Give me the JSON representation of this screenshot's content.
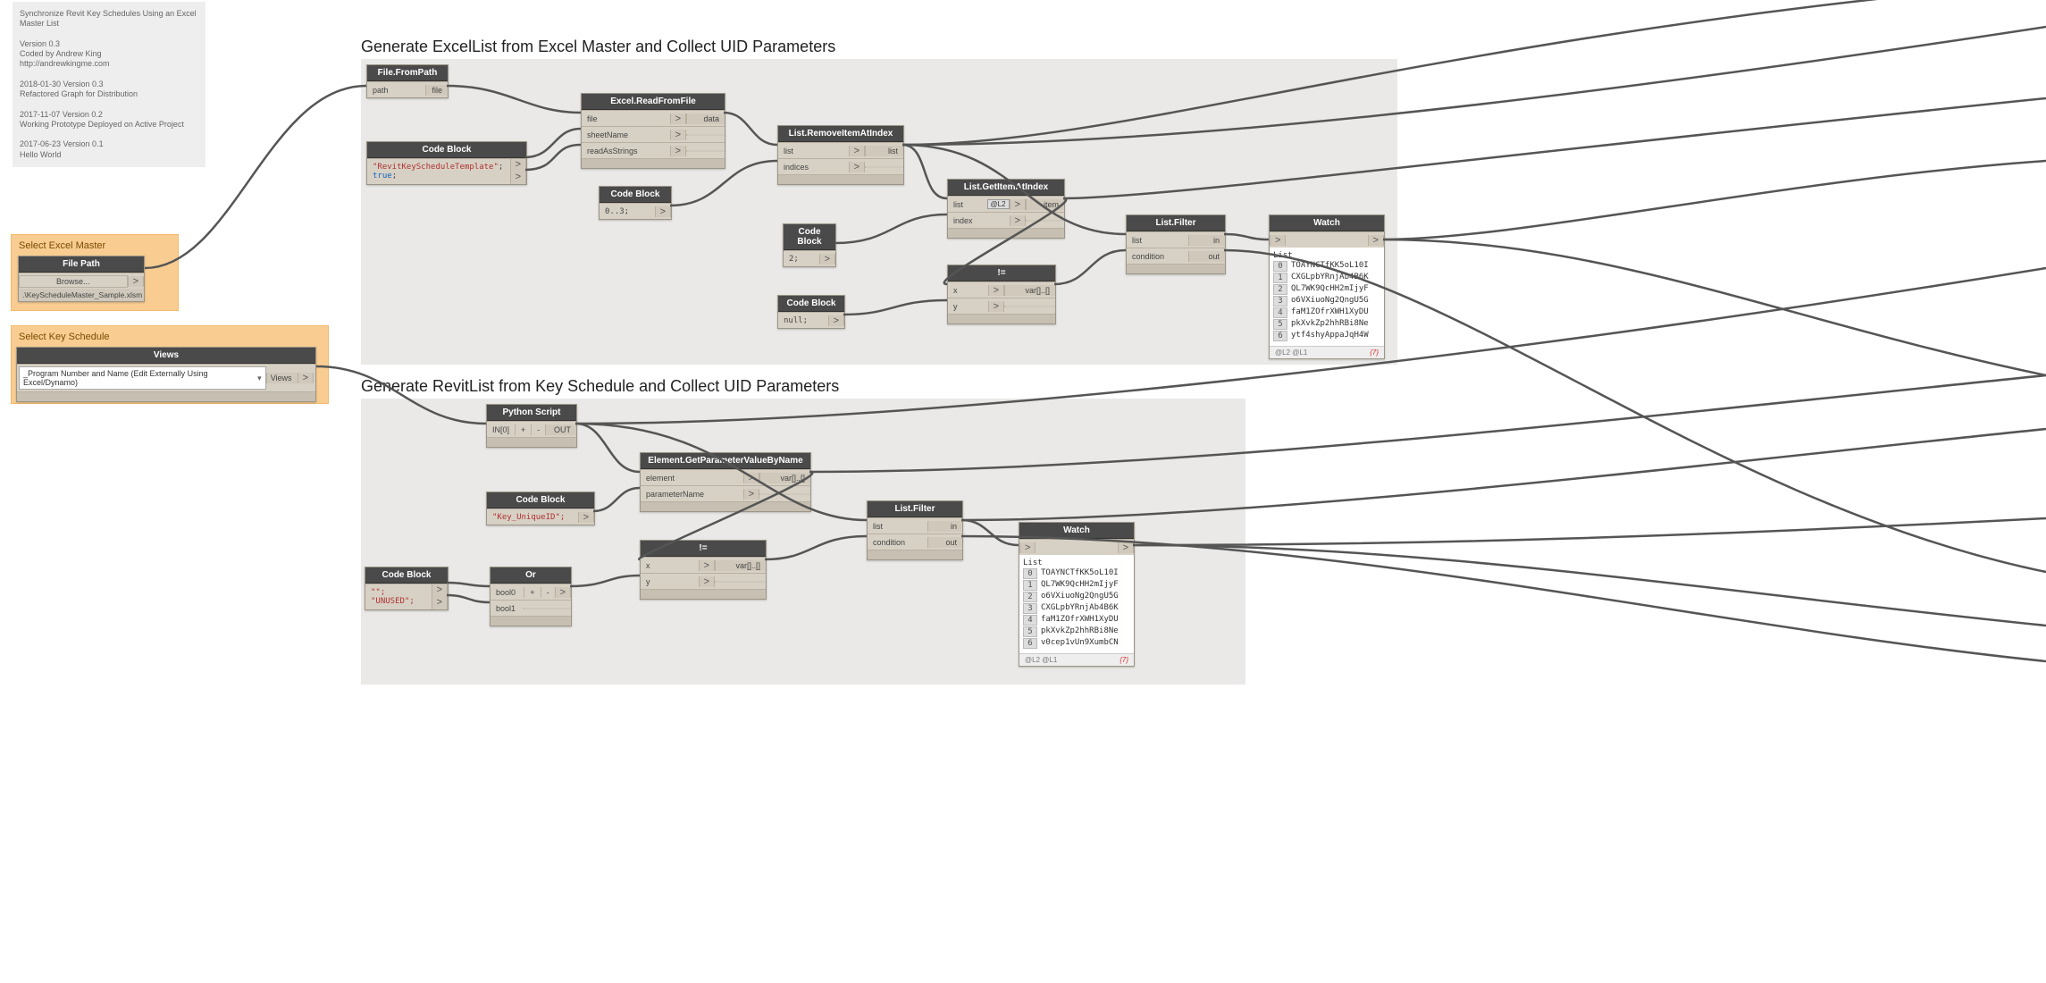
{
  "info": {
    "title": "Synchronize Revit Key Schedules Using an Excel Master List",
    "version": "Version 0.3",
    "author": "Coded by Andrew King",
    "url": "http://andrewkingme.com",
    "log": [
      "2018-01-30 Version 0.3",
      "Refactored Graph for Distribution",
      "",
      "2017-11-07 Version 0.2",
      "Working Prototype Deployed on Active Project",
      "",
      "2017-06-23 Version 0.1",
      "Hello World"
    ]
  },
  "anno1": {
    "title": "Select Excel Master"
  },
  "anno2": {
    "title": "Select Key Schedule"
  },
  "group1_title": "Generate ExcelList from Excel Master and Collect UID Parameters",
  "group2_title": "Generate RevitList from Key Schedule and Collect UID Parameters",
  "filePath": {
    "hdr": "File Path",
    "browse": "Browse...",
    "path": ".\\KeyScheduleMaster_Sample.xlsm"
  },
  "views": {
    "hdr": "Views",
    "selected": "_Program Number and Name (Edit Externally Using Excel/Dynamo)",
    "out": "Views"
  },
  "fileFromPath": {
    "hdr": "File.FromPath",
    "in": "path",
    "out": "file"
  },
  "cb1": {
    "hdr": "Code Block",
    "l1a": "\"RevitKeyScheduleTemplate\"",
    "l1b": ";",
    "l2a": "true",
    "l2b": ";"
  },
  "excelRead": {
    "hdr": "Excel.ReadFromFile",
    "p1": "file",
    "p2": "sheetName",
    "p3": "readAsStrings",
    "out": "data"
  },
  "cb2": {
    "hdr": "Code Block",
    "l": "0..3;"
  },
  "removeAt": {
    "hdr": "List.RemoveItemAtIndex",
    "p1": "list",
    "p2": "indices",
    "out": "list"
  },
  "getAt": {
    "hdr": "List.GetItemAtIndex",
    "p1": "list",
    "p2": "index",
    "out": "item",
    "lacing": "@L2"
  },
  "cb3": {
    "hdr": "Code Block",
    "l": "2;"
  },
  "cb4": {
    "hdr": "Code Block",
    "l": "null;"
  },
  "neq1": {
    "hdr": "!=",
    "p1": "x",
    "p2": "y",
    "out": "var[]..[]"
  },
  "filter1": {
    "hdr": "List.Filter",
    "p1": "list",
    "p2": "condition",
    "o1": "in",
    "o2": "out"
  },
  "watch1": {
    "hdr": "Watch",
    "listlbl": "List",
    "items": [
      "TOAYNCTfKK5oL10I",
      "CXGLpbYRnjAb4B6K",
      "QL7WK9QcHH2mIjyF",
      "o6VXiuoNg2QngU5G",
      "faM1ZOfrXWH1XyDU",
      "pkXvkZp2hhRBi8Ne",
      "ytf4shyAppaJqH4W"
    ],
    "ft": "@L2 @L1",
    "cnt": "{7}"
  },
  "py": {
    "hdr": "Python Script",
    "in": "IN[0]",
    "out": "OUT"
  },
  "cb5": {
    "hdr": "Code Block",
    "l": "\"Key_UniqueID\";"
  },
  "getParam": {
    "hdr": "Element.GetParameterValueByName",
    "p1": "element",
    "p2": "parameterName",
    "out": "var[]..[]"
  },
  "cb6": {
    "hdr": "Code Block",
    "l1": "\"\";",
    "l2": "\"UNUSED\";"
  },
  "or": {
    "hdr": "Or",
    "p1": "bool0",
    "p2": "bool1"
  },
  "neq2": {
    "hdr": "!=",
    "p1": "x",
    "p2": "y",
    "out": "var[]..[]"
  },
  "filter2": {
    "hdr": "List.Filter",
    "p1": "list",
    "p2": "condition",
    "o1": "in",
    "o2": "out"
  },
  "watch2": {
    "hdr": "Watch",
    "listlbl": "List",
    "items": [
      "TOAYNCTfKK5oL10I",
      "QL7WK9QcHH2mIjyF",
      "o6VXiuoNg2QngU5G",
      "CXGLpbYRnjAb4B6K",
      "faM1ZOfrXWH1XyDU",
      "pkXvkZp2hhRBi8Ne",
      "v0cep1vUn9XumbCN"
    ],
    "ft": "@L2 @L1",
    "cnt": "{7}"
  },
  "chev": ">"
}
